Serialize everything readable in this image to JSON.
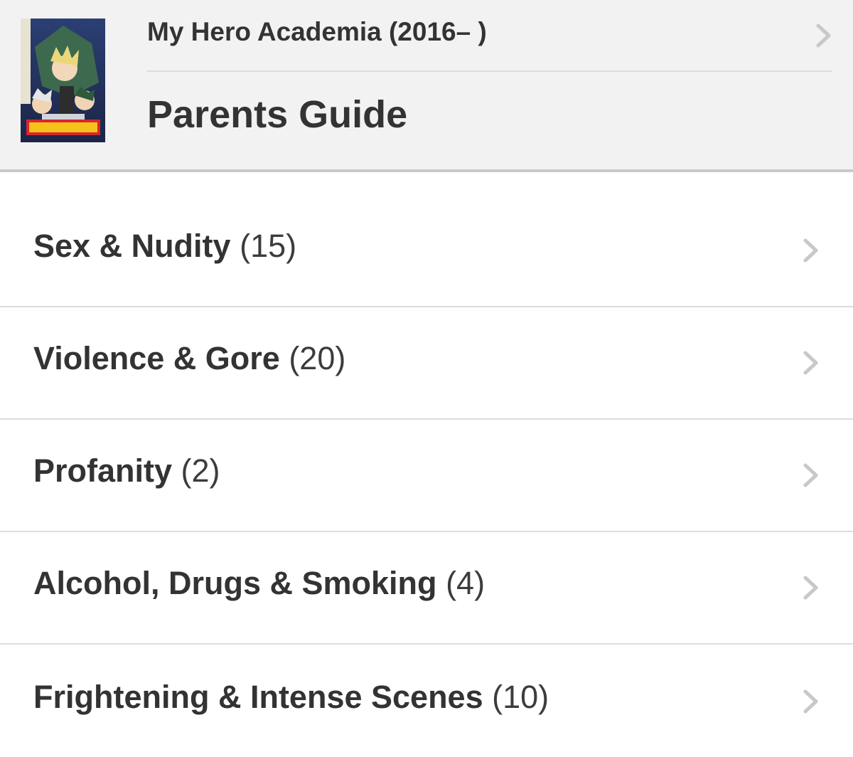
{
  "header": {
    "series_title": "My Hero Academia (2016– )",
    "page_title": "Parents Guide",
    "poster_icon": "poster-image"
  },
  "categories": [
    {
      "label": "Sex & Nudity",
      "count": "(15)"
    },
    {
      "label": "Violence & Gore",
      "count": "(20)"
    },
    {
      "label": "Profanity",
      "count": "(2)"
    },
    {
      "label": "Alcohol, Drugs & Smoking",
      "count": "(4)"
    },
    {
      "label": "Frightening & Intense Scenes",
      "count": "(10)"
    }
  ],
  "icons": {
    "chevron": "chevron-right-icon"
  },
  "colors": {
    "header_bg": "#f2f2f2",
    "text": "#333333",
    "chevron": "#c8c8c8",
    "divider": "#dddddd"
  }
}
